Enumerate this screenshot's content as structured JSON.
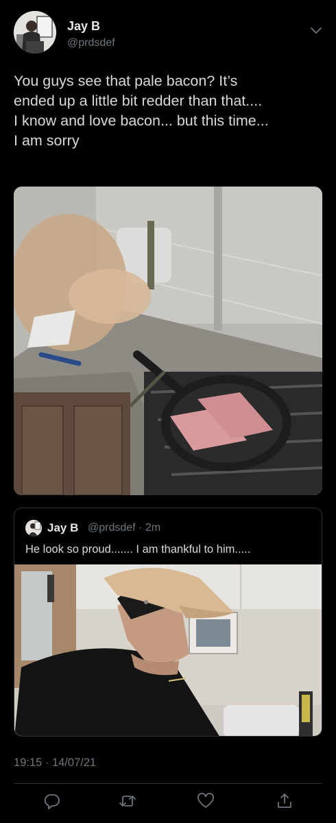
{
  "tweet": {
    "author_name": "Jay B",
    "author_handle": "@prdsdef",
    "text_lines": [
      "You guys see that pale bacon? It’s",
      "ended up a little bit redder than that....",
      "I know and love bacon... but this time...",
      "I am sorry"
    ],
    "timestamp": "19:15 · 14/07/21"
  },
  "quote": {
    "author_name": "Jay B",
    "author_handle": "@prdsdef · 2m",
    "text": "He look so proud....... I am thankful to him....."
  },
  "icons": {
    "header": "chevron-down-icon",
    "actions": [
      "reply-icon",
      "retweet-icon",
      "like-icon",
      "share-icon"
    ]
  },
  "colors": {
    "background": "#000000",
    "text": "#d9d9d9",
    "secondary_text": "#6e767d",
    "border": "#2f3336"
  }
}
